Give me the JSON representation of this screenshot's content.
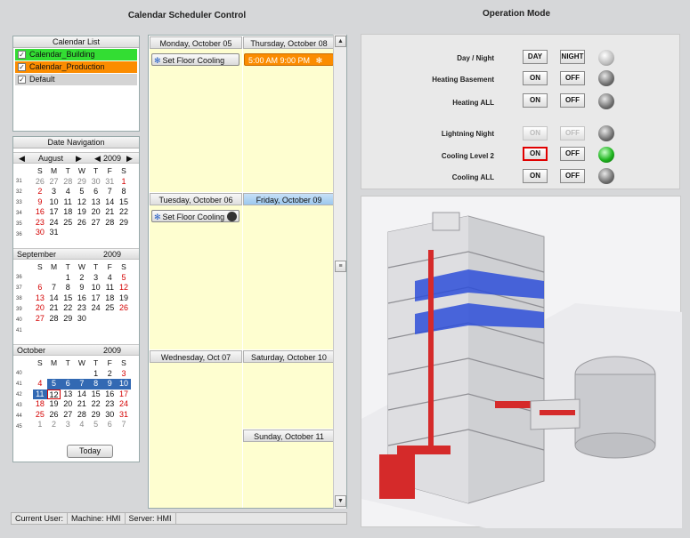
{
  "titles": {
    "scheduler": "Calendar Scheduler Control",
    "operation": "Operation Mode"
  },
  "calendar_list": {
    "header": "Calendar List",
    "items": [
      {
        "label": "Calendar_Building",
        "color": "#33dd33",
        "checked": true
      },
      {
        "label": "Calendar_Production",
        "color": "#fb8c00",
        "checked": true
      },
      {
        "label": "Default",
        "color": "#d4d4d4",
        "checked": true
      }
    ]
  },
  "date_nav": {
    "header": "Date Navigation",
    "august": {
      "name": "August",
      "year": "2009"
    },
    "september": {
      "name": "September",
      "year": "2009"
    },
    "october": {
      "name": "October",
      "year": "2009"
    },
    "dow": [
      "S",
      "M",
      "T",
      "W",
      "T",
      "F",
      "S"
    ],
    "today_label": "Today"
  },
  "week_view": {
    "days": {
      "mon": "Monday, October 05",
      "thu": "Thursday, October 08",
      "tue": "Tuesday, October 06",
      "fri": "Friday, October 09",
      "wed": "Wednesday, Oct 07",
      "sat": "Saturday, October 10",
      "sun": "Sunday, October 11"
    },
    "events": {
      "mon_cooling": "Set Floor Cooling",
      "thu_time": "5:00 AM  9:00 PM",
      "tue_cooling": "Set Floor Cooling"
    }
  },
  "status_bar": {
    "user": "Current User:",
    "machine": "Machine: HMI",
    "server": "Server: HMI"
  },
  "operation_mode": {
    "rows": [
      {
        "label": "Day / Night",
        "on": "DAY",
        "off": "NIGHT",
        "lamp": "light"
      },
      {
        "label": "Heating Basement",
        "on": "ON",
        "off": "OFF",
        "lamp": "dark"
      },
      {
        "label": "Heating ALL",
        "on": "ON",
        "off": "OFF",
        "lamp": "dark"
      },
      {
        "label": "Lightning Night",
        "on": "ON",
        "off": "OFF",
        "lamp": "dark",
        "disabled": true
      },
      {
        "label": "Cooling Level 2",
        "on": "ON",
        "off": "OFF",
        "lamp": "green",
        "active": true
      },
      {
        "label": "Cooling ALL",
        "on": "ON",
        "off": "OFF",
        "lamp": "dark"
      }
    ]
  }
}
